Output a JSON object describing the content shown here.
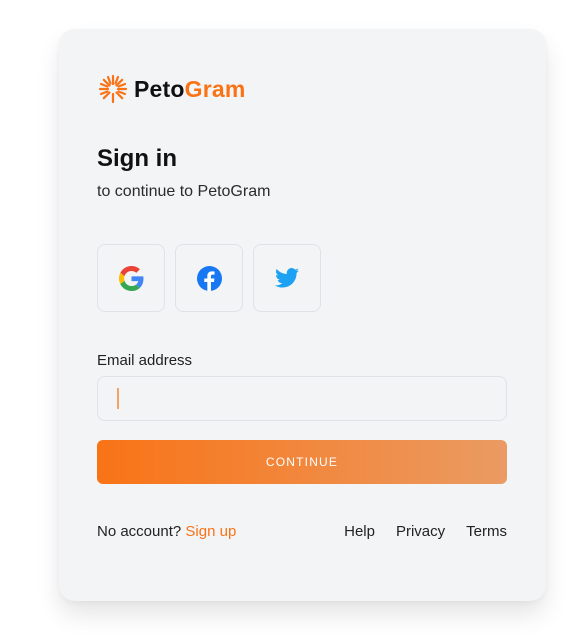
{
  "brand": {
    "name_part1": "Peto",
    "name_part2": "Gram",
    "logo_icon": "orange-sunburst-icon",
    "accent_color": "#f97316"
  },
  "heading": {
    "title": "Sign in",
    "subtitle": "to continue to PetoGram"
  },
  "social": {
    "providers": [
      {
        "icon": "google-icon"
      },
      {
        "icon": "facebook-icon"
      },
      {
        "icon": "twitter-icon"
      }
    ]
  },
  "form": {
    "email_label": "Email address",
    "email_value": "",
    "email_placeholder": "",
    "continue_label": "CONTINUE"
  },
  "footer": {
    "no_account_text": "No account?",
    "signup_label": "Sign up",
    "links": {
      "help": "Help",
      "privacy": "Privacy",
      "terms": "Terms"
    }
  }
}
